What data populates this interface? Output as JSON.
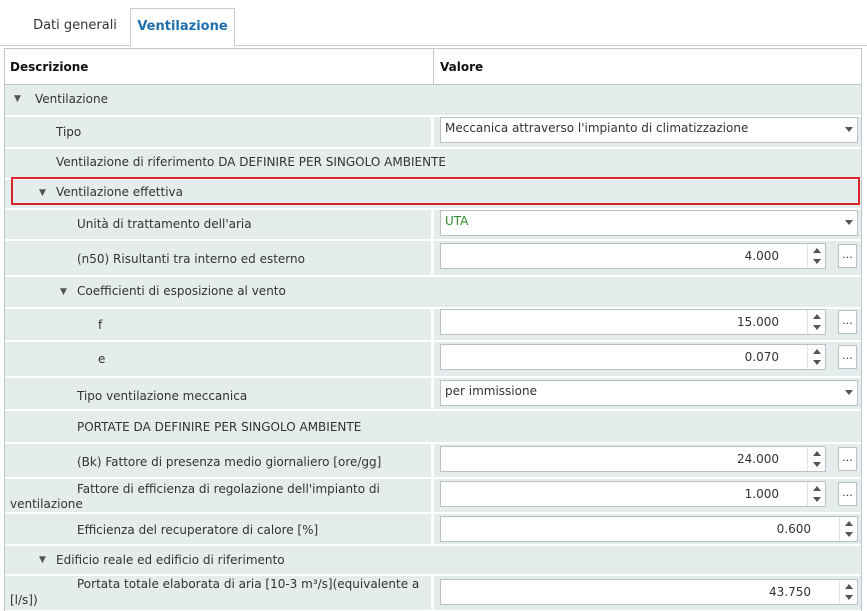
{
  "tabs": [
    {
      "label": "Dati generali",
      "active": false
    },
    {
      "label": "Ventilazione",
      "active": true
    }
  ],
  "grid": {
    "header_desc": "Descrizione",
    "header_value": "Valore"
  },
  "rows": {
    "ventilazione": {
      "label": "Ventilazione"
    },
    "tipo": {
      "label": "Tipo",
      "value": "Meccanica attraverso l'impianto di climatizzazione"
    },
    "vent_rif": {
      "label": "Ventilazione di riferimento DA DEFINIRE PER SINGOLO AMBIENTE"
    },
    "vent_eff": {
      "label": "Ventilazione effettiva"
    },
    "uta": {
      "label": "Unità di trattamento dell'aria",
      "value": "UTA"
    },
    "n50": {
      "label": "(n50) Risultanti tra interno ed esterno",
      "value": "4.000"
    },
    "coeff": {
      "label": "Coefficienti di esposizione al vento"
    },
    "f": {
      "label": "f",
      "value": "15.000"
    },
    "e": {
      "label": "e",
      "value": "0.070"
    },
    "tipo_mecc": {
      "label": "Tipo ventilazione meccanica",
      "value": "per immissione"
    },
    "portate": {
      "label": "PORTATE DA DEFINIRE PER SINGOLO AMBIENTE"
    },
    "bk": {
      "label": "(Bk) Fattore di presenza medio giornaliero [ore/gg]",
      "value": "24.000"
    },
    "fatt_eff_1": {
      "label": "Fattore di efficienza di regolazione dell'impianto di",
      "label2": "ventilazione",
      "value": "1.000"
    },
    "recup": {
      "label": "Efficienza del recuperatore di calore [%]",
      "value": "0.600"
    },
    "edificio": {
      "label": "Edificio reale ed edificio di riferimento"
    },
    "portata_tot": {
      "label": "Portata totale elaborata di aria [10-3 m³/s](equivalente a",
      "label2": "[l/s])",
      "value": "43.750"
    }
  },
  "icons": {
    "expanded": "triangle-down-icon",
    "dropdown": "chevron-down-icon",
    "ellipsis": "..."
  },
  "colors": {
    "row_bg": "#e4ecec",
    "active_tab": "#1f6fae",
    "highlight": "#d9262b",
    "uta_text": "#2e8b2e"
  }
}
